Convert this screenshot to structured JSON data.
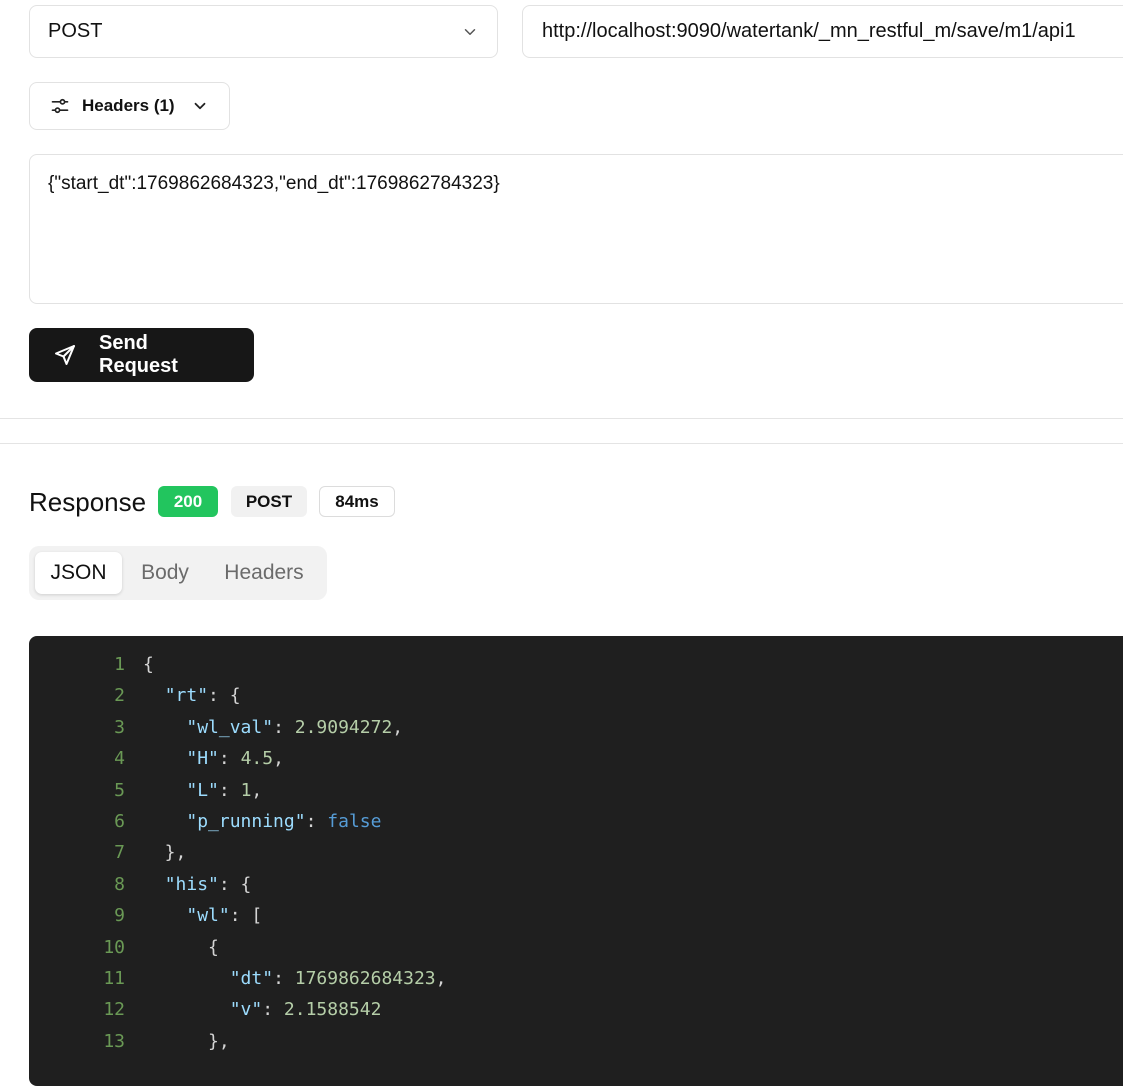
{
  "request": {
    "method": "POST",
    "url": "http://localhost:9090/watertank/_mn_restful_m/save/m1/api1",
    "headers_label": "Headers (1)",
    "body": "{\"start_dt\":1769862684323,\"end_dt\":1769862784323}",
    "send_label": "Send Request"
  },
  "response": {
    "title": "Response",
    "status": "200",
    "method": "POST",
    "time": "84ms",
    "status_color": "#22c55e",
    "tabs": [
      {
        "label": "JSON",
        "active": true
      },
      {
        "label": "Body",
        "active": false
      },
      {
        "label": "Headers",
        "active": false
      }
    ],
    "json_lines": [
      {
        "n": "1",
        "tokens": [
          {
            "t": "{",
            "c": "p"
          }
        ]
      },
      {
        "n": "2",
        "tokens": [
          {
            "t": "  ",
            "c": "p"
          },
          {
            "t": "\"rt\"",
            "c": "k"
          },
          {
            "t": ": {",
            "c": "p"
          }
        ]
      },
      {
        "n": "3",
        "tokens": [
          {
            "t": "    ",
            "c": "p"
          },
          {
            "t": "\"wl_val\"",
            "c": "k"
          },
          {
            "t": ": ",
            "c": "p"
          },
          {
            "t": "2.9094272",
            "c": "n"
          },
          {
            "t": ",",
            "c": "p"
          }
        ]
      },
      {
        "n": "4",
        "tokens": [
          {
            "t": "    ",
            "c": "p"
          },
          {
            "t": "\"H\"",
            "c": "k"
          },
          {
            "t": ": ",
            "c": "p"
          },
          {
            "t": "4.5",
            "c": "n"
          },
          {
            "t": ",",
            "c": "p"
          }
        ]
      },
      {
        "n": "5",
        "tokens": [
          {
            "t": "    ",
            "c": "p"
          },
          {
            "t": "\"L\"",
            "c": "k"
          },
          {
            "t": ": ",
            "c": "p"
          },
          {
            "t": "1",
            "c": "n"
          },
          {
            "t": ",",
            "c": "p"
          }
        ]
      },
      {
        "n": "6",
        "tokens": [
          {
            "t": "    ",
            "c": "p"
          },
          {
            "t": "\"p_running\"",
            "c": "k"
          },
          {
            "t": ": ",
            "c": "p"
          },
          {
            "t": "false",
            "c": "b"
          }
        ]
      },
      {
        "n": "7",
        "tokens": [
          {
            "t": "  },",
            "c": "p"
          }
        ]
      },
      {
        "n": "8",
        "tokens": [
          {
            "t": "  ",
            "c": "p"
          },
          {
            "t": "\"his\"",
            "c": "k"
          },
          {
            "t": ": {",
            "c": "p"
          }
        ]
      },
      {
        "n": "9",
        "tokens": [
          {
            "t": "    ",
            "c": "p"
          },
          {
            "t": "\"wl\"",
            "c": "k"
          },
          {
            "t": ": [",
            "c": "p"
          }
        ]
      },
      {
        "n": "10",
        "tokens": [
          {
            "t": "      {",
            "c": "p"
          }
        ]
      },
      {
        "n": "11",
        "tokens": [
          {
            "t": "        ",
            "c": "p"
          },
          {
            "t": "\"dt\"",
            "c": "k"
          },
          {
            "t": ": ",
            "c": "p"
          },
          {
            "t": "1769862684323",
            "c": "n"
          },
          {
            "t": ",",
            "c": "p"
          }
        ]
      },
      {
        "n": "12",
        "tokens": [
          {
            "t": "        ",
            "c": "p"
          },
          {
            "t": "\"v\"",
            "c": "k"
          },
          {
            "t": ": ",
            "c": "p"
          },
          {
            "t": "2.1588542",
            "c": "n"
          }
        ]
      },
      {
        "n": "13",
        "tokens": [
          {
            "t": "      },",
            "c": "p"
          }
        ]
      }
    ]
  },
  "icons": {
    "method_dropdown": "chevron-down-icon",
    "headers_toggle": "sliders-icon",
    "headers_expand": "chevron-down-icon",
    "send": "send-icon"
  }
}
